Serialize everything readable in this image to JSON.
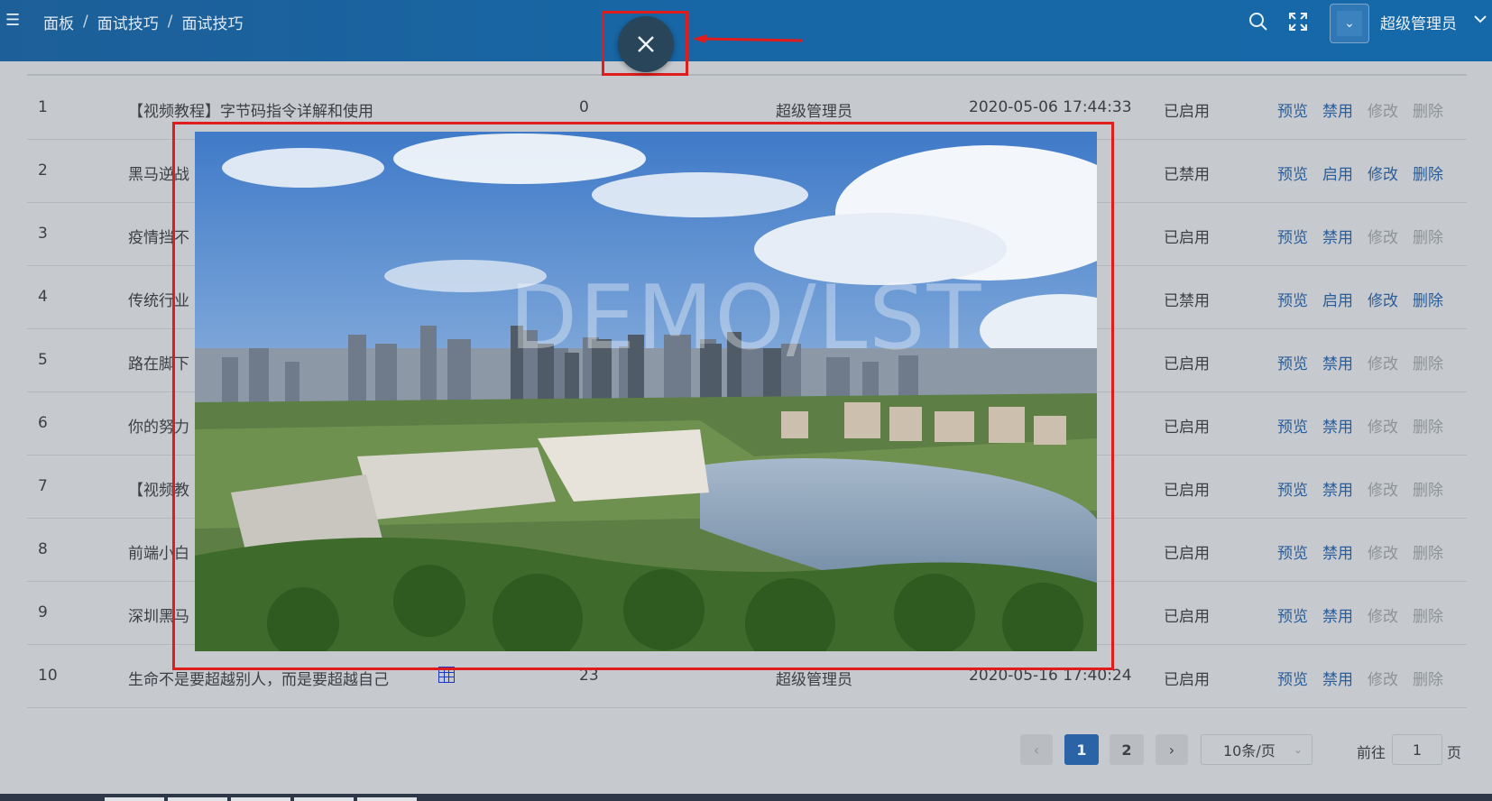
{
  "header": {
    "breadcrumb": [
      "面板",
      "面试技巧",
      "面试技巧"
    ],
    "user_name": "超级管理员"
  },
  "table": {
    "rows": [
      {
        "index": "1",
        "title": "【视频教程】字节码指令详解和使用",
        "count": "0",
        "author": "超级管理员",
        "date": "2020-05-06 17:44:33",
        "status": "已启用",
        "actions": [
          "预览",
          "禁用",
          "修改",
          "删除"
        ],
        "enabled_actions": [
          true,
          true,
          false,
          false
        ]
      },
      {
        "index": "2",
        "title": "黑马逆战",
        "count": "",
        "author": "",
        "date": "05",
        "status": "已禁用",
        "actions": [
          "预览",
          "启用",
          "修改",
          "删除"
        ],
        "enabled_actions": [
          true,
          true,
          true,
          true
        ]
      },
      {
        "index": "3",
        "title": "疫情挡不",
        "count": "",
        "author": "",
        "date": "02",
        "status": "已启用",
        "actions": [
          "预览",
          "禁用",
          "修改",
          "删除"
        ],
        "enabled_actions": [
          true,
          true,
          false,
          false
        ]
      },
      {
        "index": "4",
        "title": "传统行业",
        "count": "",
        "author": "",
        "date": "57",
        "status": "已禁用",
        "actions": [
          "预览",
          "启用",
          "修改",
          "删除"
        ],
        "enabled_actions": [
          true,
          true,
          true,
          true
        ]
      },
      {
        "index": "5",
        "title": "路在脚下",
        "count": "",
        "author": "",
        "date": "48",
        "status": "已启用",
        "actions": [
          "预览",
          "禁用",
          "修改",
          "删除"
        ],
        "enabled_actions": [
          true,
          true,
          false,
          false
        ]
      },
      {
        "index": "6",
        "title": "你的努力",
        "count": "",
        "author": "",
        "date": "38",
        "status": "已启用",
        "actions": [
          "预览",
          "禁用",
          "修改",
          "删除"
        ],
        "enabled_actions": [
          true,
          true,
          false,
          false
        ]
      },
      {
        "index": "7",
        "title": "【视频教",
        "count": "",
        "author": "",
        "date": "44",
        "status": "已启用",
        "actions": [
          "预览",
          "禁用",
          "修改",
          "删除"
        ],
        "enabled_actions": [
          true,
          true,
          false,
          false
        ]
      },
      {
        "index": "8",
        "title": "前端小白",
        "count": "",
        "author": "",
        "date": "32",
        "status": "已启用",
        "actions": [
          "预览",
          "禁用",
          "修改",
          "删除"
        ],
        "enabled_actions": [
          true,
          true,
          false,
          false
        ]
      },
      {
        "index": "9",
        "title": "深圳黑马",
        "count": "",
        "author": "",
        "date": "28",
        "status": "已启用",
        "actions": [
          "预览",
          "禁用",
          "修改",
          "删除"
        ],
        "enabled_actions": [
          true,
          true,
          false,
          false
        ]
      },
      {
        "index": "10",
        "title": "生命不是要超越别人，而是要超越自己",
        "count": "23",
        "author": "超级管理员",
        "date": "2020-05-16 17:40:24",
        "status": "已启用",
        "actions": [
          "预览",
          "禁用",
          "修改",
          "删除"
        ],
        "enabled_actions": [
          true,
          true,
          false,
          false
        ]
      }
    ]
  },
  "pagination": {
    "pages": [
      "1",
      "2"
    ],
    "current": "1",
    "page_size": "10条/页",
    "goto_label": "前往",
    "goto_value": "1",
    "page_suffix": "页"
  },
  "modal": {
    "watermark": "DEMO/LST",
    "close_icon": "close-icon"
  },
  "colors": {
    "header_blue": "#1767a6",
    "link_blue": "#2a5d9a",
    "highlight_red": "#e11c1c",
    "close_button": "#28455a"
  }
}
